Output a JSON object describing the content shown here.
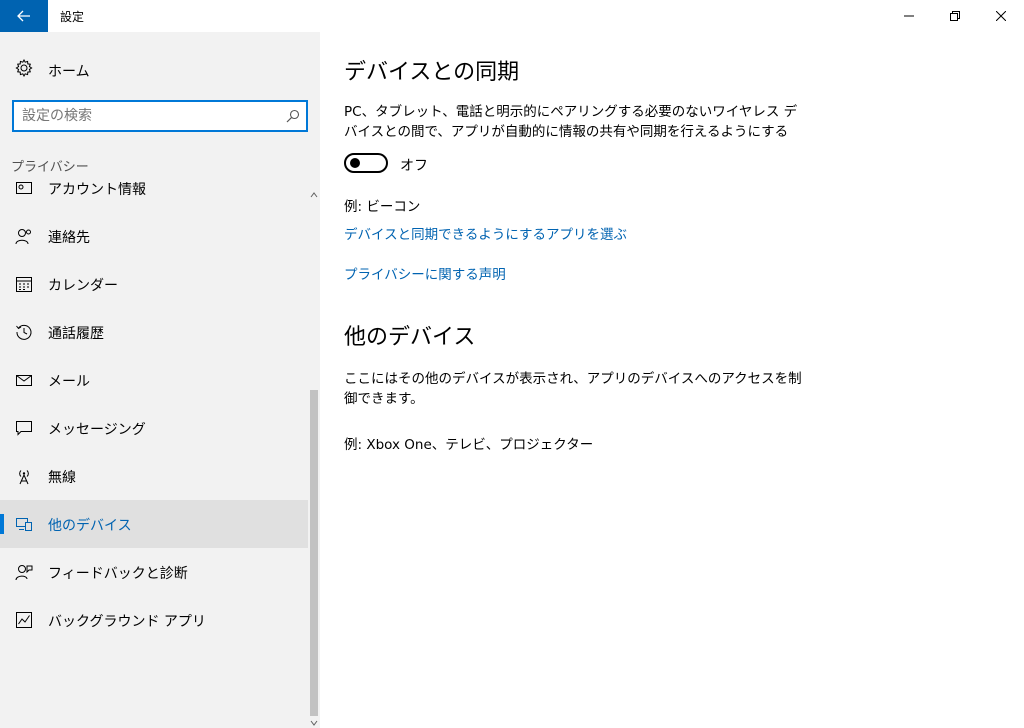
{
  "window": {
    "title": "設定"
  },
  "sidebar": {
    "home_label": "ホーム",
    "search_placeholder": "設定の検索",
    "section_header": "プライバシー",
    "items": [
      {
        "label": "アカウント情報",
        "icon": "account-info-icon"
      },
      {
        "label": "連絡先",
        "icon": "contacts-icon"
      },
      {
        "label": "カレンダー",
        "icon": "calendar-icon"
      },
      {
        "label": "通話履歴",
        "icon": "call-history-icon"
      },
      {
        "label": "メール",
        "icon": "mail-icon"
      },
      {
        "label": "メッセージング",
        "icon": "messaging-icon"
      },
      {
        "label": "無線",
        "icon": "radios-icon"
      },
      {
        "label": "他のデバイス",
        "icon": "other-devices-icon",
        "selected": true
      },
      {
        "label": "フィードバックと診断",
        "icon": "feedback-icon"
      },
      {
        "label": "バックグラウンド アプリ",
        "icon": "background-apps-icon"
      }
    ]
  },
  "main": {
    "title": "デバイスとの同期",
    "description": "PC、タブレット、電話と明示的にペアリングする必要のないワイヤレス デバイスとの間で、アプリが自動的に情報の共有や同期を行えるようにする",
    "toggle_state": "オフ",
    "example1": "例: ビーコン",
    "link_choose_apps": "デバイスと同期できるようにするアプリを選ぶ",
    "link_privacy": "プライバシーに関する声明",
    "section2_title": "他のデバイス",
    "section2_description": "ここにはその他のデバイスが表示され、アプリのデバイスへのアクセスを制御できます。",
    "example2": "例: Xbox One、テレビ、プロジェクター"
  },
  "colors": {
    "accent": "#0078d7",
    "back_button": "#0063b1",
    "link": "#0063b1",
    "sidebar_bg": "#f2f2f2",
    "selected_bg": "#e0e0e0"
  }
}
